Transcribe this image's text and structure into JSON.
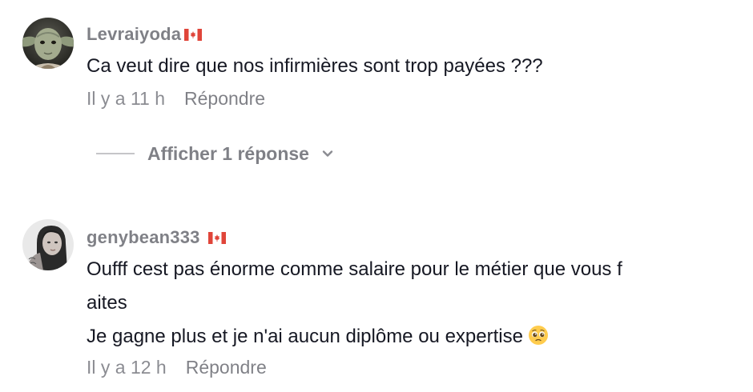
{
  "comments": [
    {
      "username": "Levraiyoda",
      "flag_icon": "canada-flag-icon",
      "avatar_icon": "yoda-avatar-icon",
      "text_lines": [
        "Ca veut dire que nos infirmières sont trop payées ???"
      ],
      "timestamp": "Il y a 11 h",
      "reply_label": "Répondre"
    },
    {
      "username": "genybean333",
      "flag_icon": "canada-flag-icon",
      "avatar_icon": "woman-avatar-icon",
      "text_lines": [
        "Oufff cest pas énorme comme salaire pour le métier que vous f",
        "aites",
        "Je gagne plus et je n'ai aucun diplôme ou expertise"
      ],
      "emoji_icon": "pleading-face-emoji-icon",
      "timestamp": "Il y a 12 h",
      "reply_label": "Répondre"
    }
  ],
  "view_replies": {
    "label": "Afficher 1 réponse",
    "icon": "chevron-down-icon"
  },
  "colors": {
    "text_primary": "#161823",
    "text_secondary": "#8a8b91",
    "flag_red": "#e0453a",
    "background": "#ffffff"
  }
}
